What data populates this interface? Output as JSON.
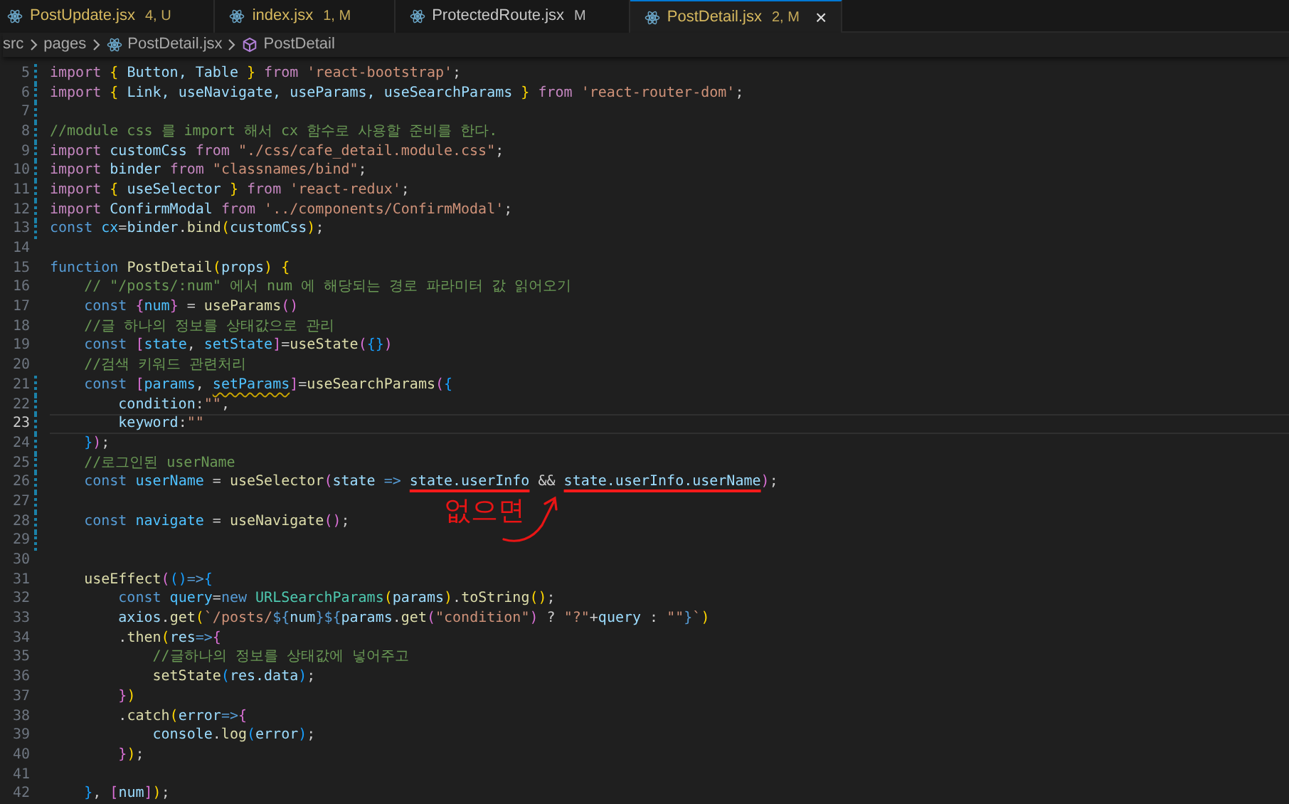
{
  "tabs": [
    {
      "label": "PostUpdate.jsx",
      "badge": "4, U",
      "color": "#d7b95f",
      "selected": false
    },
    {
      "label": "index.jsx",
      "badge": "1, M",
      "color": "#d7b95f",
      "selected": false
    },
    {
      "label": "ProtectedRoute.jsx",
      "badge": "M",
      "color": "#c8c8c8",
      "selected": false
    },
    {
      "label": "PostDetail.jsx",
      "badge": "2, M",
      "color": "#d7b95f",
      "selected": true,
      "close": "×"
    }
  ],
  "breadcrumb": [
    "src",
    "pages",
    "PostDetail.jsx",
    "PostDetail"
  ],
  "lines": [
    {
      "number": "5",
      "modified": true,
      "current": false,
      "tokens": [
        {
          "kind": "keyword",
          "text": "import "
        },
        {
          "kind": "b1",
          "text": "{"
        },
        {
          "kind": "var",
          "text": " Button, Table "
        },
        {
          "kind": "b1",
          "text": "} "
        },
        {
          "kind": "keyword",
          "text": "from "
        },
        {
          "kind": "string",
          "text": "'react-bootstrap'"
        },
        {
          "kind": "punct",
          "text": ";"
        }
      ]
    },
    {
      "number": "6",
      "modified": true,
      "current": false,
      "tokens": [
        {
          "kind": "keyword",
          "text": "import "
        },
        {
          "kind": "b1",
          "text": "{"
        },
        {
          "kind": "var",
          "text": " Link, useNavigate, useParams, useSearchParams "
        },
        {
          "kind": "b1",
          "text": "} "
        },
        {
          "kind": "keyword",
          "text": "from "
        },
        {
          "kind": "string",
          "text": "'react-router-dom'"
        },
        {
          "kind": "punct",
          "text": ";"
        }
      ]
    },
    {
      "number": "7",
      "modified": true,
      "current": false
    },
    {
      "number": "8",
      "modified": true,
      "current": false,
      "tokens": [
        {
          "kind": "comment",
          "text": "//module css 를 import 해서 cx 함수로 사용할 준비를 한다."
        }
      ]
    },
    {
      "number": "9",
      "modified": true,
      "current": false,
      "tokens": [
        {
          "kind": "keyword",
          "text": "import "
        },
        {
          "kind": "var",
          "text": "customCss "
        },
        {
          "kind": "keyword",
          "text": "from "
        },
        {
          "kind": "string",
          "text": "\"./css/cafe_detail.module.css\""
        },
        {
          "kind": "punct",
          "text": ";"
        }
      ]
    },
    {
      "number": "10",
      "modified": true,
      "current": false,
      "tokens": [
        {
          "kind": "keyword",
          "text": "import "
        },
        {
          "kind": "var",
          "text": "binder "
        },
        {
          "kind": "keyword",
          "text": "from "
        },
        {
          "kind": "string",
          "text": "\"classnames/bind\""
        },
        {
          "kind": "punct",
          "text": ";"
        }
      ]
    },
    {
      "number": "11",
      "modified": true,
      "current": false,
      "tokens": [
        {
          "kind": "keyword",
          "text": "import "
        },
        {
          "kind": "b1",
          "text": "{"
        },
        {
          "kind": "var",
          "text": " useSelector "
        },
        {
          "kind": "b1",
          "text": "} "
        },
        {
          "kind": "keyword",
          "text": "from "
        },
        {
          "kind": "string",
          "text": "'react-redux'"
        },
        {
          "kind": "punct",
          "text": ";"
        }
      ]
    },
    {
      "number": "12",
      "modified": true,
      "current": false,
      "tokens": [
        {
          "kind": "keyword",
          "text": "import "
        },
        {
          "kind": "var",
          "text": "ConfirmModal "
        },
        {
          "kind": "keyword",
          "text": "from "
        },
        {
          "kind": "string",
          "text": "'../components/ConfirmModal'"
        },
        {
          "kind": "punct",
          "text": ";"
        }
      ]
    },
    {
      "number": "13",
      "modified": true,
      "current": false,
      "tokens": [
        {
          "kind": "storage",
          "text": "const "
        },
        {
          "kind": "const",
          "text": "cx"
        },
        {
          "kind": "punct",
          "text": "="
        },
        {
          "kind": "var",
          "text": "binder"
        },
        {
          "kind": "punct",
          "text": "."
        },
        {
          "kind": "func",
          "text": "bind"
        },
        {
          "kind": "b1",
          "text": "("
        },
        {
          "kind": "var",
          "text": "customCss"
        },
        {
          "kind": "b1",
          "text": ")"
        },
        {
          "kind": "punct",
          "text": ";"
        }
      ]
    },
    {
      "number": "14",
      "modified": false,
      "current": false
    },
    {
      "number": "15",
      "modified": false,
      "current": false,
      "tokens": [
        {
          "kind": "storage",
          "text": "function "
        },
        {
          "kind": "func",
          "text": "PostDetail"
        },
        {
          "kind": "b1",
          "text": "("
        },
        {
          "kind": "var",
          "text": "props"
        },
        {
          "kind": "b1",
          "text": ") {"
        }
      ]
    },
    {
      "number": "16",
      "modified": false,
      "current": false,
      "tokens": [
        {
          "kind": "comment",
          "text": "    // \"/posts/:num\" 에서 num 에 해당되는 경로 파라미터 값 읽어오기"
        }
      ]
    },
    {
      "number": "17",
      "modified": false,
      "current": false,
      "tokens": [
        {
          "kind": "storage",
          "text": "    const "
        },
        {
          "kind": "b2",
          "text": "{"
        },
        {
          "kind": "const",
          "text": "num"
        },
        {
          "kind": "b2",
          "text": "}"
        },
        {
          "kind": "punct",
          "text": " = "
        },
        {
          "kind": "func",
          "text": "useParams"
        },
        {
          "kind": "b2",
          "text": "()"
        }
      ]
    },
    {
      "number": "18",
      "modified": false,
      "current": false,
      "tokens": [
        {
          "kind": "comment",
          "text": "    //글 하나의 정보를 상태값으로 관리"
        }
      ]
    },
    {
      "number": "19",
      "modified": false,
      "current": false,
      "tokens": [
        {
          "kind": "storage",
          "text": "    const "
        },
        {
          "kind": "b2",
          "text": "["
        },
        {
          "kind": "const",
          "text": "state"
        },
        {
          "kind": "punct",
          "text": ", "
        },
        {
          "kind": "const",
          "text": "setState"
        },
        {
          "kind": "b2",
          "text": "]"
        },
        {
          "kind": "punct",
          "text": "="
        },
        {
          "kind": "func",
          "text": "useState"
        },
        {
          "kind": "b2",
          "text": "("
        },
        {
          "kind": "b3",
          "text": "{}"
        },
        {
          "kind": "b2",
          "text": ")"
        }
      ]
    },
    {
      "number": "20",
      "modified": false,
      "current": false,
      "tokens": [
        {
          "kind": "comment",
          "text": "    //검색 키워드 관련처리"
        }
      ]
    },
    {
      "number": "21",
      "modified": true,
      "current": false,
      "tokens": [
        {
          "kind": "storage",
          "text": "    const "
        },
        {
          "kind": "b2",
          "text": "["
        },
        {
          "kind": "const",
          "text": "params"
        },
        {
          "kind": "punct",
          "text": ", "
        },
        {
          "kind": "const",
          "text": "setParams",
          "warning": true
        },
        {
          "kind": "b2",
          "text": "]"
        },
        {
          "kind": "punct",
          "text": "="
        },
        {
          "kind": "func",
          "text": "useSearchParams"
        },
        {
          "kind": "b2",
          "text": "("
        },
        {
          "kind": "b3",
          "text": "{"
        }
      ]
    },
    {
      "number": "22",
      "modified": true,
      "current": false,
      "tokens": [
        {
          "kind": "var",
          "text": "        condition"
        },
        {
          "kind": "punct",
          "text": ":"
        },
        {
          "kind": "string",
          "text": "\"\""
        },
        {
          "kind": "punct",
          "text": ","
        }
      ]
    },
    {
      "number": "23",
      "modified": true,
      "current": true,
      "tokens": [
        {
          "kind": "var",
          "text": "        keyword"
        },
        {
          "kind": "punct",
          "text": ":"
        },
        {
          "kind": "string",
          "text": "\"\""
        }
      ]
    },
    {
      "number": "24",
      "modified": true,
      "current": false,
      "tokens": [
        {
          "kind": "b3",
          "text": "    }"
        },
        {
          "kind": "b2",
          "text": ")"
        },
        {
          "kind": "punct",
          "text": ";"
        }
      ]
    },
    {
      "number": "25",
      "modified": true,
      "current": false,
      "tokens": [
        {
          "kind": "comment",
          "text": "    //로그인된 userName"
        }
      ]
    },
    {
      "number": "26",
      "modified": true,
      "current": false,
      "tokens": [
        {
          "kind": "storage",
          "text": "    const "
        },
        {
          "kind": "const",
          "text": "userName"
        },
        {
          "kind": "punct",
          "text": " = "
        },
        {
          "kind": "func",
          "text": "useSelector"
        },
        {
          "kind": "b2",
          "text": "("
        },
        {
          "kind": "var",
          "text": "state "
        },
        {
          "kind": "storage",
          "text": "=> "
        },
        {
          "kind": "var",
          "text": "state.userInfo",
          "marked": true
        },
        {
          "kind": "punct",
          "text": " && "
        },
        {
          "kind": "var",
          "text": "state.userInfo.userName",
          "marked": true
        },
        {
          "kind": "b2",
          "text": ")"
        },
        {
          "kind": "punct",
          "text": ";"
        }
      ]
    },
    {
      "number": "27",
      "modified": true,
      "current": false
    },
    {
      "number": "28",
      "modified": true,
      "current": false,
      "tokens": [
        {
          "kind": "storage",
          "text": "    const "
        },
        {
          "kind": "const",
          "text": "navigate"
        },
        {
          "kind": "punct",
          "text": " = "
        },
        {
          "kind": "func",
          "text": "useNavigate"
        },
        {
          "kind": "b2",
          "text": "()"
        },
        {
          "kind": "punct",
          "text": ";"
        }
      ]
    },
    {
      "number": "29",
      "modified": true,
      "current": false
    },
    {
      "number": "30",
      "modified": false,
      "current": false
    },
    {
      "number": "31",
      "modified": false,
      "current": false,
      "tokens": [
        {
          "kind": "func",
          "text": "    useEffect"
        },
        {
          "kind": "b2",
          "text": "("
        },
        {
          "kind": "b3",
          "text": "()"
        },
        {
          "kind": "storage",
          "text": "=>"
        },
        {
          "kind": "b3",
          "text": "{"
        }
      ]
    },
    {
      "number": "32",
      "modified": false,
      "current": false,
      "tokens": [
        {
          "kind": "storage",
          "text": "        const "
        },
        {
          "kind": "const",
          "text": "query"
        },
        {
          "kind": "punct",
          "text": "="
        },
        {
          "kind": "storage",
          "text": "new "
        },
        {
          "kind": "type",
          "text": "URLSearchParams"
        },
        {
          "kind": "b1",
          "text": "("
        },
        {
          "kind": "var",
          "text": "params"
        },
        {
          "kind": "b1",
          "text": ")"
        },
        {
          "kind": "punct",
          "text": "."
        },
        {
          "kind": "func",
          "text": "toString"
        },
        {
          "kind": "b1",
          "text": "()"
        },
        {
          "kind": "punct",
          "text": ";"
        }
      ]
    },
    {
      "number": "33",
      "modified": false,
      "current": false,
      "tokens": [
        {
          "kind": "var",
          "text": "        axios"
        },
        {
          "kind": "punct",
          "text": "."
        },
        {
          "kind": "func",
          "text": "get"
        },
        {
          "kind": "b1",
          "text": "("
        },
        {
          "kind": "string",
          "text": "`/posts/"
        },
        {
          "kind": "storage",
          "text": "${"
        },
        {
          "kind": "var",
          "text": "num"
        },
        {
          "kind": "storage",
          "text": "}${"
        },
        {
          "kind": "var",
          "text": "params"
        },
        {
          "kind": "punct",
          "text": "."
        },
        {
          "kind": "func",
          "text": "get"
        },
        {
          "kind": "b2",
          "text": "("
        },
        {
          "kind": "string",
          "text": "\"condition\""
        },
        {
          "kind": "b2",
          "text": ")"
        },
        {
          "kind": "punct",
          "text": " ? "
        },
        {
          "kind": "string",
          "text": "\"?\""
        },
        {
          "kind": "punct",
          "text": "+"
        },
        {
          "kind": "var",
          "text": "query"
        },
        {
          "kind": "punct",
          "text": " : "
        },
        {
          "kind": "string",
          "text": "\"\""
        },
        {
          "kind": "storage",
          "text": "}"
        },
        {
          "kind": "string",
          "text": "`"
        },
        {
          "kind": "b1",
          "text": ")"
        }
      ]
    },
    {
      "number": "34",
      "modified": false,
      "current": false,
      "tokens": [
        {
          "kind": "punct",
          "text": "        ."
        },
        {
          "kind": "func",
          "text": "then"
        },
        {
          "kind": "b1",
          "text": "("
        },
        {
          "kind": "var",
          "text": "res"
        },
        {
          "kind": "storage",
          "text": "=>"
        },
        {
          "kind": "b2",
          "text": "{"
        }
      ]
    },
    {
      "number": "35",
      "modified": false,
      "current": false,
      "tokens": [
        {
          "kind": "comment",
          "text": "            //글하나의 정보를 상태값에 넣어주고"
        }
      ]
    },
    {
      "number": "36",
      "modified": false,
      "current": false,
      "tokens": [
        {
          "kind": "func",
          "text": "            setState"
        },
        {
          "kind": "b3",
          "text": "("
        },
        {
          "kind": "var",
          "text": "res.data"
        },
        {
          "kind": "b3",
          "text": ")"
        },
        {
          "kind": "punct",
          "text": ";"
        }
      ]
    },
    {
      "number": "37",
      "modified": false,
      "current": false,
      "tokens": [
        {
          "kind": "b2",
          "text": "        }"
        },
        {
          "kind": "b1",
          "text": ")"
        }
      ]
    },
    {
      "number": "38",
      "modified": false,
      "current": false,
      "tokens": [
        {
          "kind": "punct",
          "text": "        ."
        },
        {
          "kind": "func",
          "text": "catch"
        },
        {
          "kind": "b1",
          "text": "("
        },
        {
          "kind": "var",
          "text": "error"
        },
        {
          "kind": "storage",
          "text": "=>"
        },
        {
          "kind": "b2",
          "text": "{"
        }
      ]
    },
    {
      "number": "39",
      "modified": false,
      "current": false,
      "tokens": [
        {
          "kind": "var",
          "text": "            console"
        },
        {
          "kind": "punct",
          "text": "."
        },
        {
          "kind": "func",
          "text": "log"
        },
        {
          "kind": "b3",
          "text": "("
        },
        {
          "kind": "var",
          "text": "error"
        },
        {
          "kind": "b3",
          "text": ")"
        },
        {
          "kind": "punct",
          "text": ";"
        }
      ]
    },
    {
      "number": "40",
      "modified": false,
      "current": false,
      "tokens": [
        {
          "kind": "b2",
          "text": "        }"
        },
        {
          "kind": "b1",
          "text": ")"
        },
        {
          "kind": "punct",
          "text": ";"
        }
      ]
    },
    {
      "number": "41",
      "modified": false,
      "current": false
    },
    {
      "number": "42",
      "modified": false,
      "current": false,
      "tokens": [
        {
          "kind": "b3",
          "text": "    }"
        },
        {
          "kind": "punct",
          "text": ", "
        },
        {
          "kind": "b2",
          "text": "["
        },
        {
          "kind": "var",
          "text": "num"
        },
        {
          "kind": "b2",
          "text": "]"
        },
        {
          "kind": "b1",
          "text": ")"
        },
        {
          "kind": "punct",
          "text": ";"
        }
      ]
    }
  ],
  "annotation": {
    "text": "없으면"
  }
}
